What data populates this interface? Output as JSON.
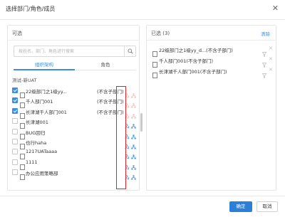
{
  "dialog": {
    "title": "选择部门/角色/成员",
    "close_icon": "close-icon"
  },
  "left": {
    "title": "可选",
    "search": {
      "placeholder": "按姓名、部门、角色进行搜索",
      "value": "",
      "icon": "search-icon"
    },
    "tabs": [
      {
        "label": "组织架构",
        "active": true
      },
      {
        "label": "角色",
        "active": false
      }
    ],
    "crumb": "测试-新UAT",
    "hint_text": "(不含子部门)",
    "nodes": [
      {
        "label": "22级部门之1级yy...",
        "checked": true,
        "hint": "(不含子部门)",
        "actions_faded": true
      },
      {
        "label": "千人部门001",
        "checked": true,
        "hint": "(不含子部门)",
        "actions_faded": true
      },
      {
        "label": "长津湖千人部门001",
        "checked": true,
        "hint": "(不含子部门)",
        "actions_faded": true
      },
      {
        "label": "长津湖001",
        "checked": false,
        "hint": "",
        "actions_faded": false
      },
      {
        "label": "BUG回归",
        "checked": false,
        "hint": "",
        "actions_faded": false
      },
      {
        "label": "也行haha",
        "checked": false,
        "hint": "",
        "actions_faded": false
      },
      {
        "label": "1217UATaaaa",
        "checked": false,
        "hint": "",
        "actions_faded": false
      },
      {
        "label": "1111",
        "checked": false,
        "hint": "",
        "actions_faded": false
      },
      {
        "label": "办公应用策略部",
        "checked": false,
        "hint": "",
        "actions_faded": false
      }
    ],
    "action_icons": [
      "subordinate-icon",
      "org-structure-icon"
    ]
  },
  "right": {
    "title": "已选 (3)",
    "clear_label": "清除",
    "items": [
      {
        "label": "22级部门之1级yy_d...(不含子部门)"
      },
      {
        "label": "千人部门001(不含子部门)"
      },
      {
        "label": "长津湖千人部门001(不含子部门)"
      }
    ]
  },
  "footer": {
    "ok_label": "确定",
    "cancel_label": "取消"
  },
  "colors": {
    "accent": "#3a8ee6",
    "primary_button": "#2b7fd8",
    "highlight_box": "#e02424"
  }
}
